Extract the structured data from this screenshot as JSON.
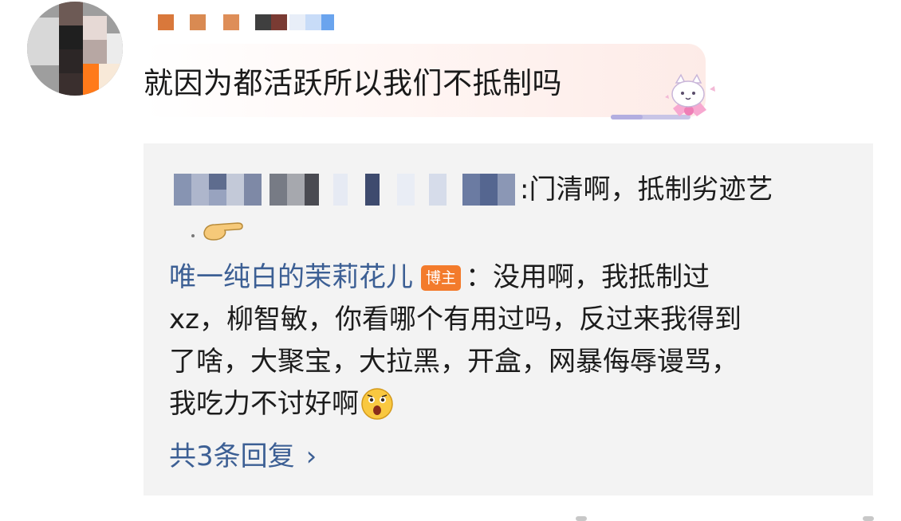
{
  "comment": {
    "text": "就因为都活跃所以我们不抵制吗"
  },
  "replies": {
    "first": {
      "text": ":门清啊，抵制劣迹艺"
    },
    "second": {
      "author": "唯一纯白的茉莉花儿",
      "badge": "博主",
      "text_lines": [
        "：没用啊，我抵制过",
        "xz，柳智敏，你看哪个有用过吗，反过来我得到",
        "了啥，大聚宝，大拉黑，开盒，网暴侮辱谩骂，",
        "我吃力不讨好啊"
      ]
    },
    "more_label": "共3条回复",
    "more_chevron": "›"
  },
  "colors": {
    "link_blue": "#3c5f94",
    "badge_orange": "#f37b2c",
    "panel_grey": "#f3f3f3",
    "bubble_pink": "#fdebe7"
  },
  "icons": {
    "hand": "pointing-hand-icon",
    "emoji": "shocked-face-icon",
    "sticker": "cat-bow-sticker-icon",
    "chevron": "chevron-right-icon"
  }
}
